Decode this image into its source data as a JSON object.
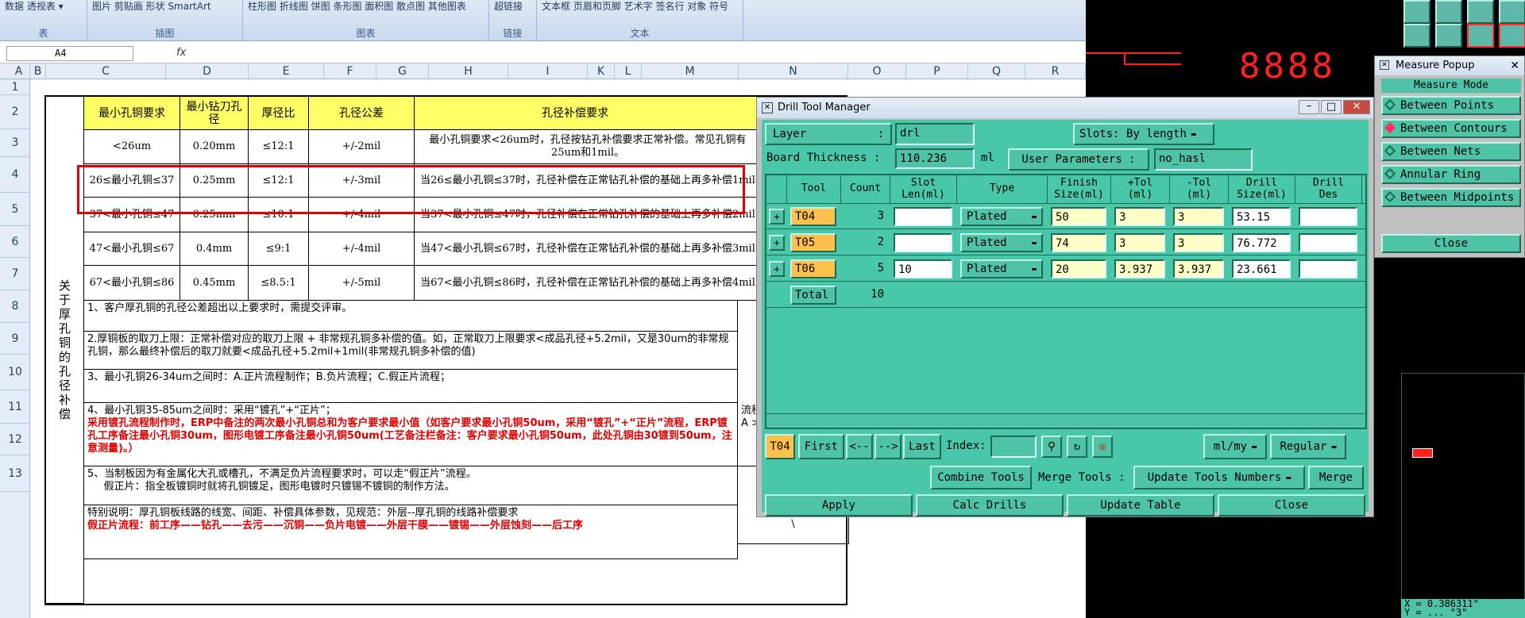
{
  "excel": {
    "ribbon_groups": [
      {
        "top": "数据\n透视表 ▾",
        "label": "表"
      },
      {
        "top": "图片  剪贴画  形状  SmartArt",
        "label": "插图"
      },
      {
        "top": "柱形图 折线图 饼图 条形图 面积图 散点图 其他图表",
        "label": "图表"
      },
      {
        "top": "超链接",
        "label": "链接"
      },
      {
        "top": "文本框 页眉和页脚 艺术字 签名行 对象  符号",
        "label": "文本"
      }
    ],
    "name_box": "A4",
    "fx": "fx",
    "columns": [
      "A",
      "B",
      "C",
      "D",
      "E",
      "F",
      "G",
      "H",
      "I",
      "K",
      "L",
      "M",
      "N",
      "O",
      "P",
      "Q",
      "R"
    ],
    "rows": [
      "1",
      "2",
      "3",
      "4",
      "5",
      "6",
      "7",
      "8",
      "9",
      "10",
      "11",
      "12",
      "13"
    ],
    "table": {
      "side_label": "关于厚孔铜的孔径补偿",
      "headers": [
        "最小孔铜要求",
        "最小钻刀孔径",
        "厚径比",
        "孔径公差",
        "孔径补偿要求"
      ],
      "rows": [
        [
          "<26um",
          "0.20mm",
          "≤12:1",
          "+/-2mil",
          "最小孔铜要求<26um时，孔径按钻孔补偿要求正常补偿。常见孔铜有25um和1mil。"
        ],
        [
          "26≤最小孔铜≤37",
          "0.25mm",
          "≤12:1",
          "+/-3mil",
          "当26≤最小孔铜≤37时，孔径补偿在正常钻孔补偿的基础上再多补偿1mil"
        ],
        [
          "37<最小孔铜≤47",
          "0.25mm",
          "≤10:1",
          "+/-4mil",
          "当37<最小孔铜≤47时，孔径补偿在正常钻孔补偿的基础上再多补偿2mil"
        ],
        [
          "47<最小孔铜≤67",
          "0.4mm",
          "≤9:1",
          "+/-4mil",
          "当47<最小孔铜≤67时，孔径补偿在正常钻孔补偿的基础上再多补偿3mil"
        ],
        [
          "67<最小孔铜≤86",
          "0.45mm",
          "≤8.5:1",
          "+/-5mil",
          "当67<最小孔铜≤86时，孔径补偿在正常钻孔补偿的基础上再多补偿4mil"
        ]
      ],
      "notes": [
        {
          "text": "1、客户厚孔铜的孔径公差超出以上要求时，需提交评审。",
          "red": ""
        },
        {
          "text": "2.厚铜板的取刀上限：正常补偿对应的取刀上限 + 非常规孔铜多补偿的值。如，正常取刀上限要求<成品孔径+5.2mil，又是30um的非常规孔铜，那么最终补偿后的取刀就要<成品孔径+5.2mil+1mil(非常规孔铜多补偿的值)",
          "red": ""
        },
        {
          "text": "3、最小孔铜26-34um之间时：A.正片流程制作；B.负片流程；C.假正片流程；",
          "red": ""
        },
        {
          "text": "4、最小孔铜35-85um之间时：采用“镀孔”+“正片”；",
          "red": "采用镀孔流程制作时，ERP中备注的两次最小孔铜总和为客户要求最小值（如客户要求最小孔铜50um，采用“镀孔”+“正片”流程，ERP镀孔工序备注最小孔铜30um，图形电镀工序备注最小孔铜50um(工艺备注栏备注：客户要求最小孔铜50um，此处孔铜由30镀到50um，注意测量)。）"
        },
        {
          "text": "5、当制板因为有金属化大孔或槽孔，不满足负片流程要求时，可以走“假正片”流程。\n     假正片：指全板镀铜时就将孔铜镀足，图形电镀时只镀锡不镀铜的制作方法。",
          "red": ""
        },
        {
          "text": "特别说明：厚孔铜板线路的线宽、间距、补偿具体参数，见规范：外层--厚孔铜的线路补偿要求",
          "red": "假正片流程：前工序——钻孔——去污——沉铜——负片电镀——外层干膜——镀锡——外层蚀刻——后工序"
        }
      ],
      "n_col_text_10": "流程\nA >",
      "n_col_text_12": "\\"
    }
  },
  "cam": {
    "digits": "8888",
    "coord_x": "X = 0.386311\"",
    "coord_y": "Y = ... \"3\""
  },
  "dtm": {
    "title": "Drill Tool Manager",
    "layer_label": "Layer",
    "layer_colon": ":",
    "layer_value": "drl",
    "slots_label": "Slots:",
    "slots_value": "By length",
    "board_thickness_label": "Board Thickness :",
    "board_thickness_value": "110.236",
    "board_thickness_unit": "ml",
    "user_params_label": "User Parameters :",
    "user_params_value": "no_hasl",
    "grid_headers": [
      "Tool",
      "Count",
      "Slot\nLen(ml)",
      "Type",
      "Finish\nSize(ml)",
      "+Tol\n(ml)",
      "-Tol\n(ml)",
      "Drill\nSize(ml)",
      "Drill\nDes"
    ],
    "rows": [
      {
        "tool": "T04",
        "count": "3",
        "slot": "",
        "type": "Plated",
        "finish": "50",
        "ptol": "3",
        "mtol": "3",
        "drill": "53.15",
        "des": ""
      },
      {
        "tool": "T05",
        "count": "2",
        "slot": "",
        "type": "Plated",
        "finish": "74",
        "ptol": "3",
        "mtol": "3",
        "drill": "76.772",
        "des": ""
      },
      {
        "tool": "T06",
        "count": "5",
        "slot": "10",
        "type": "Plated",
        "finish": "20",
        "ptol": "3.937",
        "mtol": "3.937",
        "drill": "23.661",
        "des": ""
      }
    ],
    "total_label": "Total",
    "total_count": "10",
    "nav_current": "T04",
    "nav_first": "First",
    "nav_prev": "<--",
    "nav_next": "-->",
    "nav_last": "Last",
    "index_label": "Index:",
    "units_value": "ml/my",
    "mode_value": "Regular",
    "combine_tools": "Combine Tools",
    "merge_tools_label": "Merge Tools :",
    "update_numbers": "Update Tools Numbers",
    "merge": "Merge",
    "apply": "Apply",
    "calc_drills": "Calc Drills",
    "update_table": "Update Table",
    "close": "Close"
  },
  "measure": {
    "title": "Measure Popup",
    "mode_label": "Measure Mode",
    "items": [
      "Between Points",
      "Between Contours",
      "Between Nets",
      "Annular Ring",
      "Between Midpoints"
    ],
    "selected_index": 1,
    "close": "Close"
  },
  "colors": {
    "cam_teal": "#48c8a8",
    "highlight_red": "#e00000",
    "header_yellow": "#ffff66",
    "tool_orange": "#ffc04c"
  }
}
